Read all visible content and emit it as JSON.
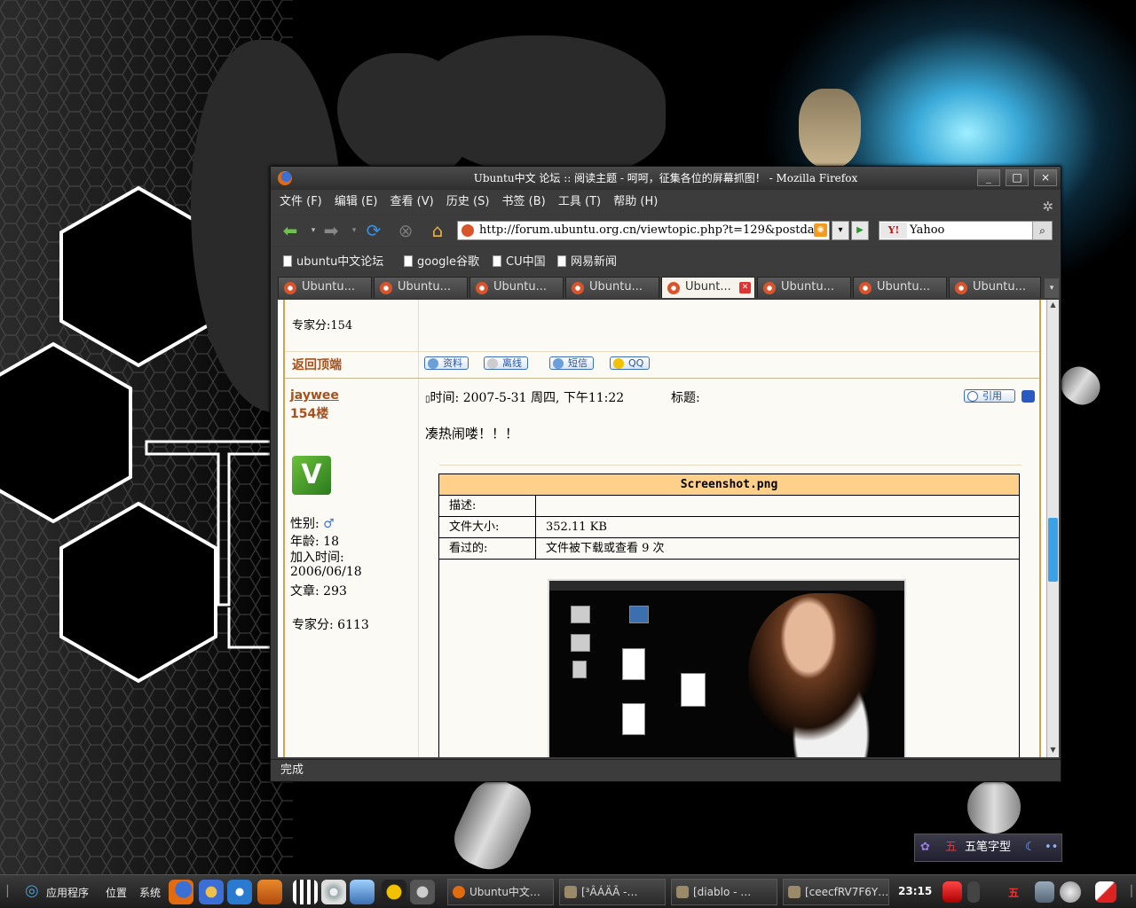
{
  "window": {
    "title": "Ubuntu中文 论坛 :: 阅读主题 - 呵呵，征集各位的屏幕抓图！ - Mozilla Firefox",
    "min": "_",
    "max": "□",
    "close": "×"
  },
  "menu": [
    "文件 (F)",
    "编辑 (E)",
    "查看 (V)",
    "历史 (S)",
    "书签 (B)",
    "工具 (T)",
    "帮助 (H)"
  ],
  "nav": {
    "url": "http://forum.ubuntu.org.cn/viewtopic.php?t=129&postda",
    "search_engine": "Y!",
    "search_value": "Yahoo"
  },
  "bookmarks": [
    "ubuntu中文论坛",
    "google谷歌",
    "CU中国",
    "网易新闻"
  ],
  "tabs": [
    "Ubuntu...",
    "Ubuntu...",
    "Ubuntu...",
    "Ubuntu...",
    "Ubunt...",
    "Ubuntu...",
    "Ubuntu...",
    "Ubuntu..."
  ],
  "active_tab": 4,
  "status": "完成",
  "post_prev": {
    "score_label": "专家分:",
    "score": "154",
    "back_to_top": "返回顶端",
    "buttons": [
      "资料",
      "离线",
      "短信",
      "QQ"
    ]
  },
  "post": {
    "author": "jaywee",
    "floor": "154楼",
    "gender_label": "性别:",
    "gender_icon": "♂",
    "age_label": "年龄:",
    "age": "18",
    "joined_label": "加入时间:",
    "joined": "2006/06/18",
    "posts_label": "文章:",
    "posts": "293",
    "score_label": "专家分:",
    "score": "6113",
    "time_label": "时间:",
    "time": "2007-5-31 周四, 下午11:22",
    "subject_label": "标题:",
    "quote_button": "引用",
    "body": "凑热闹喽！！！",
    "attachment": {
      "filename": "Screenshot.png",
      "desc_label": "描述:",
      "desc": "",
      "size_label": "文件大小:",
      "size": "352.11 KB",
      "viewed_label": "看过的:",
      "viewed": "文件被下载或查看 9 次"
    }
  },
  "taskbar": {
    "menus": [
      "应用程序",
      "位置",
      "系统"
    ],
    "tasks": [
      "Ubuntu中文…",
      "[³ÂÁÄÃ -…",
      "[diablo - …",
      "[ceecfRV7F6Y…"
    ],
    "clock": "23:15"
  },
  "ime": {
    "mark": "五",
    "label": "五笔字型"
  },
  "colors": {
    "accent": "#d4a24a",
    "link": "#a8501c",
    "attach_header": "#ffd08a",
    "scroll_thumb": "#3aa2e6"
  }
}
